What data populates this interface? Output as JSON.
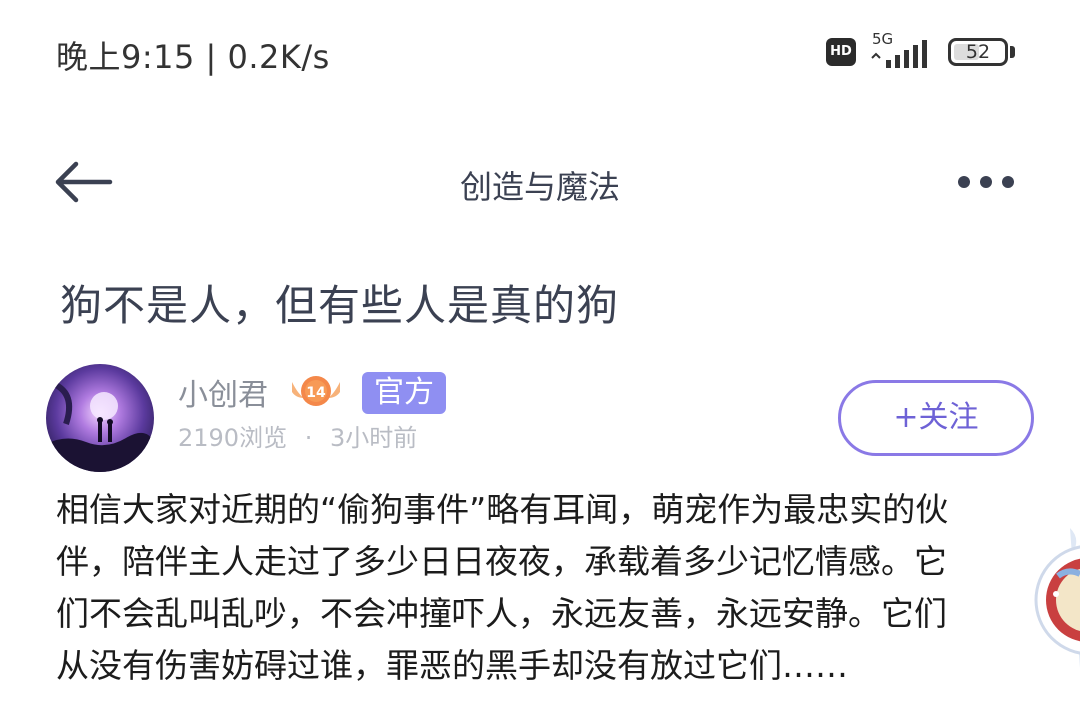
{
  "status_bar": {
    "time_speed": "晚上9:15 | 0.2K/s",
    "hd": "HD",
    "network": "5G",
    "battery": "52",
    "battery_level": 0.52
  },
  "nav": {
    "title": "创造与魔法",
    "back_icon": "arrow-left-icon",
    "more_icon": "more-dots-icon"
  },
  "post": {
    "title": "狗不是人，但有些人是真的狗",
    "author": {
      "name": "小创君",
      "level": "14",
      "official_label": "官方"
    },
    "meta": {
      "views": "2190浏览",
      "separator": "·",
      "time": "3小时前"
    },
    "follow_label": "+关注",
    "body_lines": [
      "相信大家对近期的“偷狗事件”略有耳闻，萌宠作为最忠实的伙",
      "伴，陪伴主人走过了多少日日夜夜，承载着多少记忆情感。它",
      "们不会乱叫乱吵，不会冲撞吓人，永远友善，永远安静。它们",
      "从没有伤害妨碍过谁，罪恶的黑手却没有放过它们……"
    ]
  },
  "colors": {
    "accent": "#8a79e6",
    "official_bg": "#8f8ff2",
    "title_text": "#3b4152"
  }
}
